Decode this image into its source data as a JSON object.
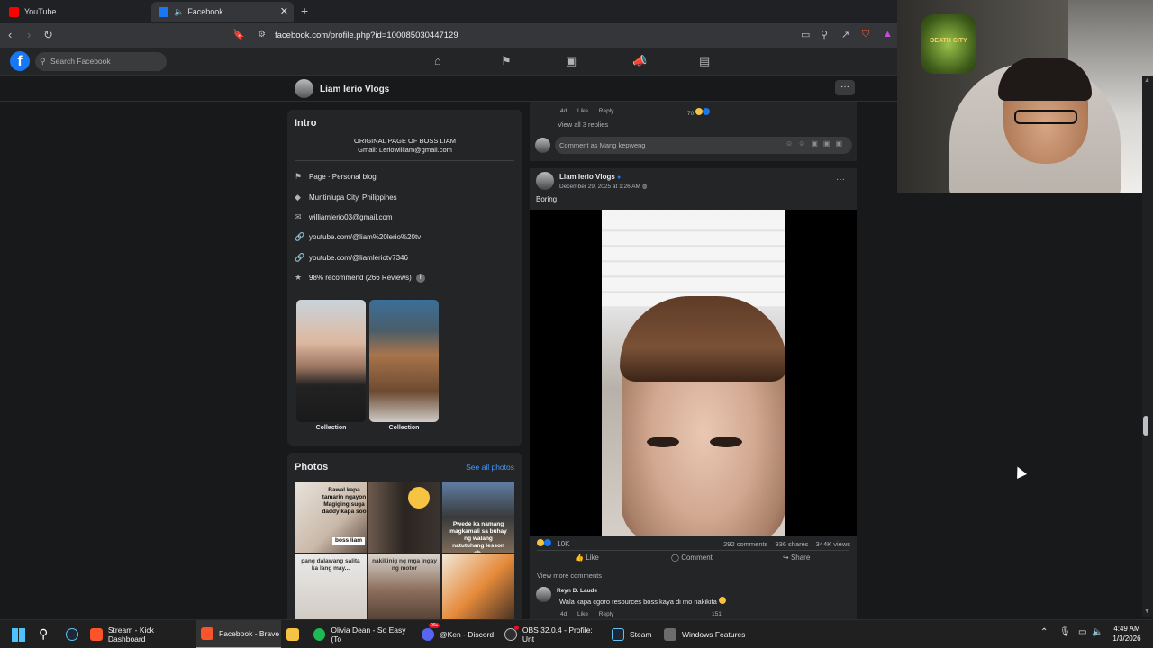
{
  "browser": {
    "tabs": [
      {
        "label": "YouTube",
        "color": "#ff0000"
      },
      {
        "label": "Facebook",
        "color": "#1877f2"
      }
    ],
    "url": "facebook.com/profile.php?id=100085030447129"
  },
  "fb": {
    "logo": "f",
    "search_placeholder": "Search Facebook"
  },
  "page": {
    "name": "Liam Ierio Vlogs",
    "more": "···"
  },
  "intro": {
    "title": "Intro",
    "bio_line1": "ORIGINAL PAGE OF BOSS LIAM",
    "bio_line2": "Gmail: Leriowilliam@gmail.com",
    "details": [
      {
        "icon": "flag-icon",
        "text": "Page · Personal blog"
      },
      {
        "icon": "location-icon",
        "text": "Muntinlupa City, Philippines"
      },
      {
        "icon": "mail-icon",
        "text": "williamlerio03@gmail.com"
      },
      {
        "icon": "link-icon",
        "text": "youtube.com/@liam%20lerio%20tv"
      },
      {
        "icon": "link-icon",
        "text": "youtube.com/@liamleriotv7346"
      },
      {
        "icon": "star-icon",
        "text": "98% recommend (266 Reviews)"
      }
    ],
    "collections": [
      "Collection",
      "Collection"
    ]
  },
  "photos": {
    "title": "Photos",
    "see_all": "See all photos",
    "captions": {
      "p1": "Bawal kapa tamarin ngayon Magiging suga daddy kapa soo",
      "p1b": "boss liam",
      "p3": "Pwede ka namang magkamali sa buhay ng walang natutuhang lesson eh.",
      "p4": "pang dalawang salita ka lang may...",
      "p5": "nakikinig ng mga ingay ng motor"
    }
  },
  "feed": {
    "reply_meta_time": "4d",
    "reply_like": "Like",
    "reply_reply": "Reply",
    "reply_count": "70",
    "view_replies": "View all 3 replies",
    "comment_as": "Comment as Mang kepweng",
    "post": {
      "author": "Liam Ierio Vlogs",
      "date": "December 29, 2025 at 1:26 AM",
      "text": "Boring",
      "reactions": "10K",
      "comments": "292 comments",
      "shares": "936 shares",
      "views": "344K views",
      "like": "Like",
      "comment": "Comment",
      "share": "Share",
      "view_more": "View more comments"
    },
    "comment": {
      "author": "Reyn D. Laude",
      "text": "Wala kapa cgoro resources boss kaya di mo nakikita",
      "time": "4d",
      "like": "Like",
      "reply": "Reply",
      "count": "151"
    }
  },
  "webcam": {
    "badge_text": "DEATH CITY"
  },
  "taskbar": {
    "items": [
      {
        "label": "Stream - Kick Dashboard",
        "color": "#fb542b"
      },
      {
        "label": "Facebook - Brave",
        "color": "#fb542b"
      },
      {
        "label": "",
        "color": "#f6c343"
      },
      {
        "label": "Olivia Dean - So Easy (To",
        "color": "#1db954"
      },
      {
        "label": "@Ken - Discord",
        "color": "#5865f2"
      },
      {
        "label": "OBS 32.0.4 - Profile: Unt",
        "color": "#302e31"
      },
      {
        "label": "Steam",
        "color": "#1b2838"
      },
      {
        "label": "Windows Features",
        "color": "#6c6c6c"
      }
    ],
    "time": "4:49 AM",
    "date": "1/3/2026",
    "discord_badge": "99+"
  }
}
